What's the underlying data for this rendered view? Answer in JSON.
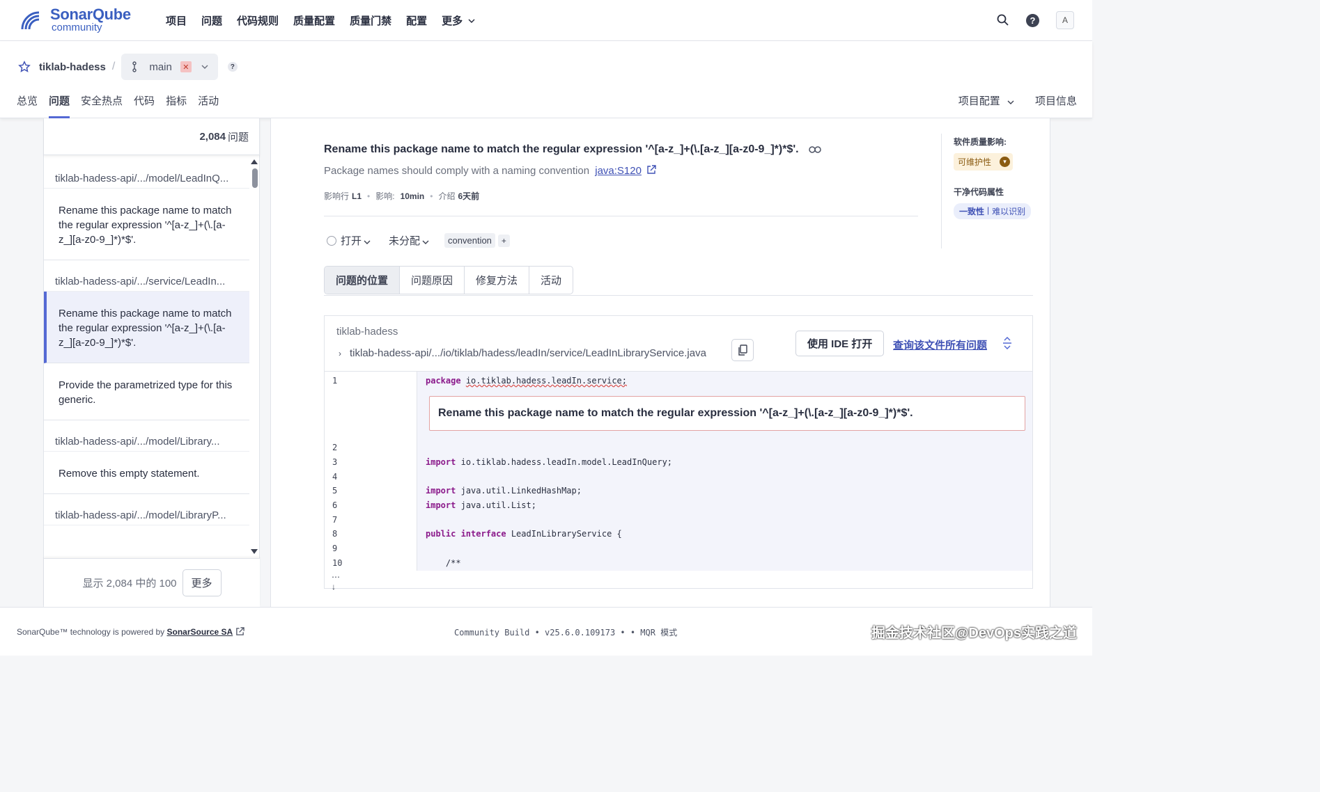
{
  "brand": {
    "name": "SonarQube",
    "sub": "community"
  },
  "topnav": [
    "项目",
    "问题",
    "代码规则",
    "质量配置",
    "质量门禁",
    "配置",
    "更多"
  ],
  "user": {
    "avatar": "A"
  },
  "project": {
    "name": "tiklab-hadess",
    "branch": "main",
    "help": "?"
  },
  "project_tabs": [
    "总览",
    "问题",
    "安全热点",
    "代码",
    "指标",
    "活动"
  ],
  "project_right": {
    "config": "项目配置",
    "info": "项目信息"
  },
  "issue_count": {
    "number": "2,084",
    "label": "问题"
  },
  "issue_list": [
    {
      "file": "tiklab-hadess-api/.../model/LeadInQ...",
      "items": [
        {
          "text": "Rename this package name to match the regular expression '^[a-z_]+(\\.[a-z_][a-z0-9_]*)*$'.",
          "selected": false
        }
      ]
    },
    {
      "file": "tiklab-hadess-api/.../service/LeadIn...",
      "items": [
        {
          "text": "Rename this package name to match the regular expression '^[a-z_]+(\\.[a-z_][a-z0-9_]*)*$'.",
          "selected": true
        },
        {
          "text": "Provide the parametrized type for this generic.",
          "selected": false
        }
      ]
    },
    {
      "file": "tiklab-hadess-api/.../model/Library...",
      "items": [
        {
          "text": "Remove this empty statement.",
          "selected": false
        }
      ]
    },
    {
      "file": "tiklab-hadess-api/.../model/LibraryP...",
      "items": []
    }
  ],
  "pager": {
    "text": "显示 2,084 中的 100",
    "more": "更多"
  },
  "issue": {
    "title": "Rename this package name to match the regular expression '^[a-z_]+(\\.[a-z_][a-z0-9_]*)*$'.",
    "subtitle": "Package names should comply with a naming convention",
    "rule": "java:S120",
    "meta": {
      "line_label": "影响行",
      "line": "L1",
      "effort_label": "影响:",
      "effort": "10min",
      "intro_label": "介绍",
      "intro": "6天前"
    },
    "status": "打开",
    "assignee": "未分配",
    "tag": "convention",
    "plus": "+",
    "tabs": [
      "问题的位置",
      "问题原因",
      "修复方法",
      "活动"
    ],
    "impact_label": "软件质量影响:",
    "impact": "可维护性",
    "clean_label": "干净代码属性",
    "clean_a": "一致性",
    "clean_b": "难以识别"
  },
  "code": {
    "project": "tiklab-hadess",
    "path": "tiklab-hadess-api/.../io/tiklab/hadess/leadIn/service/LeadInLibraryService.java",
    "ide_button": "使用 IDE 打开",
    "query_link": "查询该文件所有问题",
    "message": "Rename this package name to match the regular expression '^[a-z_]+(\\.[a-z_][a-z0-9_]*)*$'.",
    "lines": [
      {
        "n": "1",
        "kw": "package",
        "rest": "io.tiklab.hadess.leadIn.service;"
      },
      {
        "n": "2",
        "kw": "",
        "rest": ""
      },
      {
        "n": "3",
        "kw": "import",
        "rest": "io.tiklab.hadess.leadIn.model.LeadInQuery;"
      },
      {
        "n": "4",
        "kw": "",
        "rest": ""
      },
      {
        "n": "5",
        "kw": "import",
        "rest": "java.util.LinkedHashMap;"
      },
      {
        "n": "6",
        "kw": "import",
        "rest": "java.util.List;"
      },
      {
        "n": "7",
        "kw": "",
        "rest": ""
      },
      {
        "n": "8",
        "kw": "public interface",
        "rest": "LeadInLibraryService {"
      },
      {
        "n": "9",
        "kw": "",
        "rest": ""
      },
      {
        "n": "10",
        "kw": "",
        "rest": "    /**"
      }
    ]
  },
  "footer": {
    "left": "SonarQube™ technology is powered by",
    "left_link": "SonarSource SA",
    "center": "Community Build • v25.6.0.109173 • • MQR 模式",
    "watermark": "掘金技术社区@DevOps实践之道"
  }
}
